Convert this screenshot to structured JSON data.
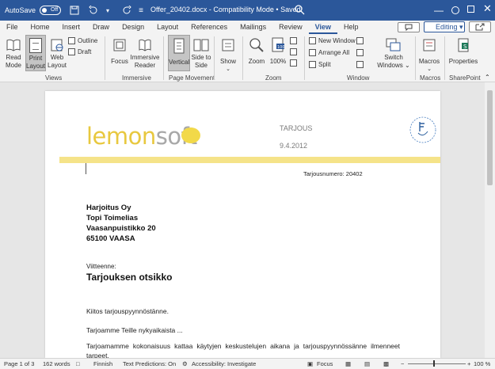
{
  "titlebar": {
    "autosave_label": "AutoSave",
    "autosave_state": "Off",
    "title": "Offer_20402.docx  -  Compatibility Mode  •  Saved",
    "bg_color": "#2b579a"
  },
  "tabs": [
    "File",
    "Home",
    "Insert",
    "Draw",
    "Design",
    "Layout",
    "References",
    "Mailings",
    "Review",
    "View",
    "Help"
  ],
  "active_tab": "View",
  "header_right": {
    "editing_label": "Editing"
  },
  "ribbon": {
    "views": {
      "read_mode": "Read Mode",
      "print_layout": "Print Layout",
      "web_layout": "Web Layout",
      "outline": "Outline",
      "draft": "Draft",
      "label": "Views"
    },
    "immersive": {
      "focus": "Focus",
      "immersive_reader": "Immersive Reader",
      "label": "Immersive"
    },
    "page_movement": {
      "vertical": "Vertical",
      "side_to_side": "Side to Side",
      "label": "Page Movement"
    },
    "show": {
      "show": "Show"
    },
    "zoom": {
      "zoom": "Zoom",
      "hundred": "100%",
      "label": "Zoom"
    },
    "window": {
      "new_window": "New Window",
      "arrange_all": "Arrange All",
      "split": "Split",
      "switch_windows": "Switch Windows",
      "label": "Window"
    },
    "macros": {
      "macros": "Macros",
      "label": "Macros"
    },
    "sharepoint": {
      "properties": "Properties",
      "label": "SharePoint"
    }
  },
  "document": {
    "logo_part1": "lemon",
    "logo_part2": "soft",
    "doc_type": "TARJOUS",
    "date": "9.4.2012",
    "offer_number": "Tarjousnumero: 20402",
    "address": [
      "Harjoitus Oy",
      "Topi Toimelias",
      "Vaasanpuistikko 20",
      "65100  VAASA"
    ],
    "subject_label": "Viitteenne:",
    "subject_title": "Tarjouksen otsikko",
    "paragraphs": [
      "Kiitos tarjouspyynnöstänne.",
      "Tarjoamme Teille nykyaikaista ...",
      "Tarjoamamme kokonaisuus kattaa käytyjen keskustelujen aikana ja tarjouspyynnössänne ilmenneet tarpeet."
    ]
  },
  "statusbar": {
    "page": "Page 1 of 3",
    "words": "162 words",
    "language": "Finnish",
    "text_predictions": "Text Predictions: On",
    "accessibility": "Accessibility: Investigate",
    "focus": "Focus",
    "zoom_minus": "−",
    "zoom_plus": "+",
    "zoom_level": "100 %"
  }
}
